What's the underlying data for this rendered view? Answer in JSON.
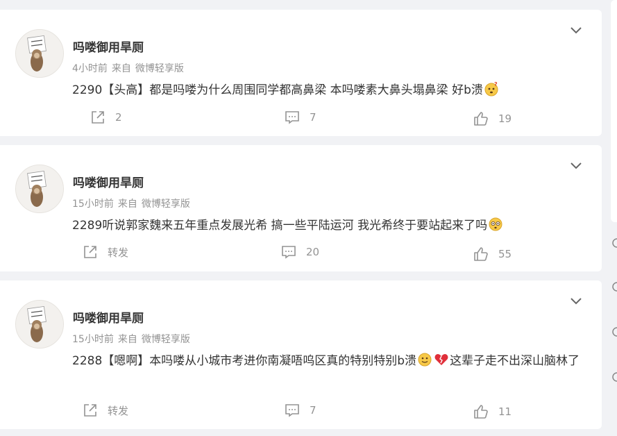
{
  "posts": [
    {
      "name": "吗喽御用旱厕",
      "time": "4小时前",
      "source_prefix": "来自",
      "source": "微博轻享版",
      "text_a": "2290【头高】都是吗喽为什么周围同学都高鼻梁 本吗喽素大鼻头塌鼻梁 好b溃",
      "text_b": "",
      "emojis": [
        "question-face-icon"
      ],
      "repost": "2",
      "comments": "7",
      "likes": "19"
    },
    {
      "name": "吗喽御用旱厕",
      "time": "15小时前",
      "source_prefix": "来自",
      "source": "微博轻享版",
      "text_a": "2289听说郭家魏来五年重点发展光希 搞一些平陆运河 我光希终于要站起来了吗",
      "text_b": "",
      "emojis": [
        "flushed-face-icon"
      ],
      "repost": "转发",
      "comments": "20",
      "likes": "55"
    },
    {
      "name": "吗喽御用旱厕",
      "time": "15小时前",
      "source_prefix": "来自",
      "source": "微博轻享版",
      "text_a": "2288【嗯啊】本吗喽从小城市考进你南凝唔呜区真的特别特别b溃",
      "text_b": "这辈子走不出深山脑林了",
      "emojis": [
        "smile-face-icon",
        "broken-heart-icon"
      ],
      "repost": "转发",
      "comments": "7",
      "likes": "11"
    }
  ],
  "avatar_sign_text": "吗喽的命也是命",
  "colors": {
    "background": "#f1f2f5",
    "card": "#ffffff",
    "meta": "#939393",
    "text": "#333333"
  }
}
